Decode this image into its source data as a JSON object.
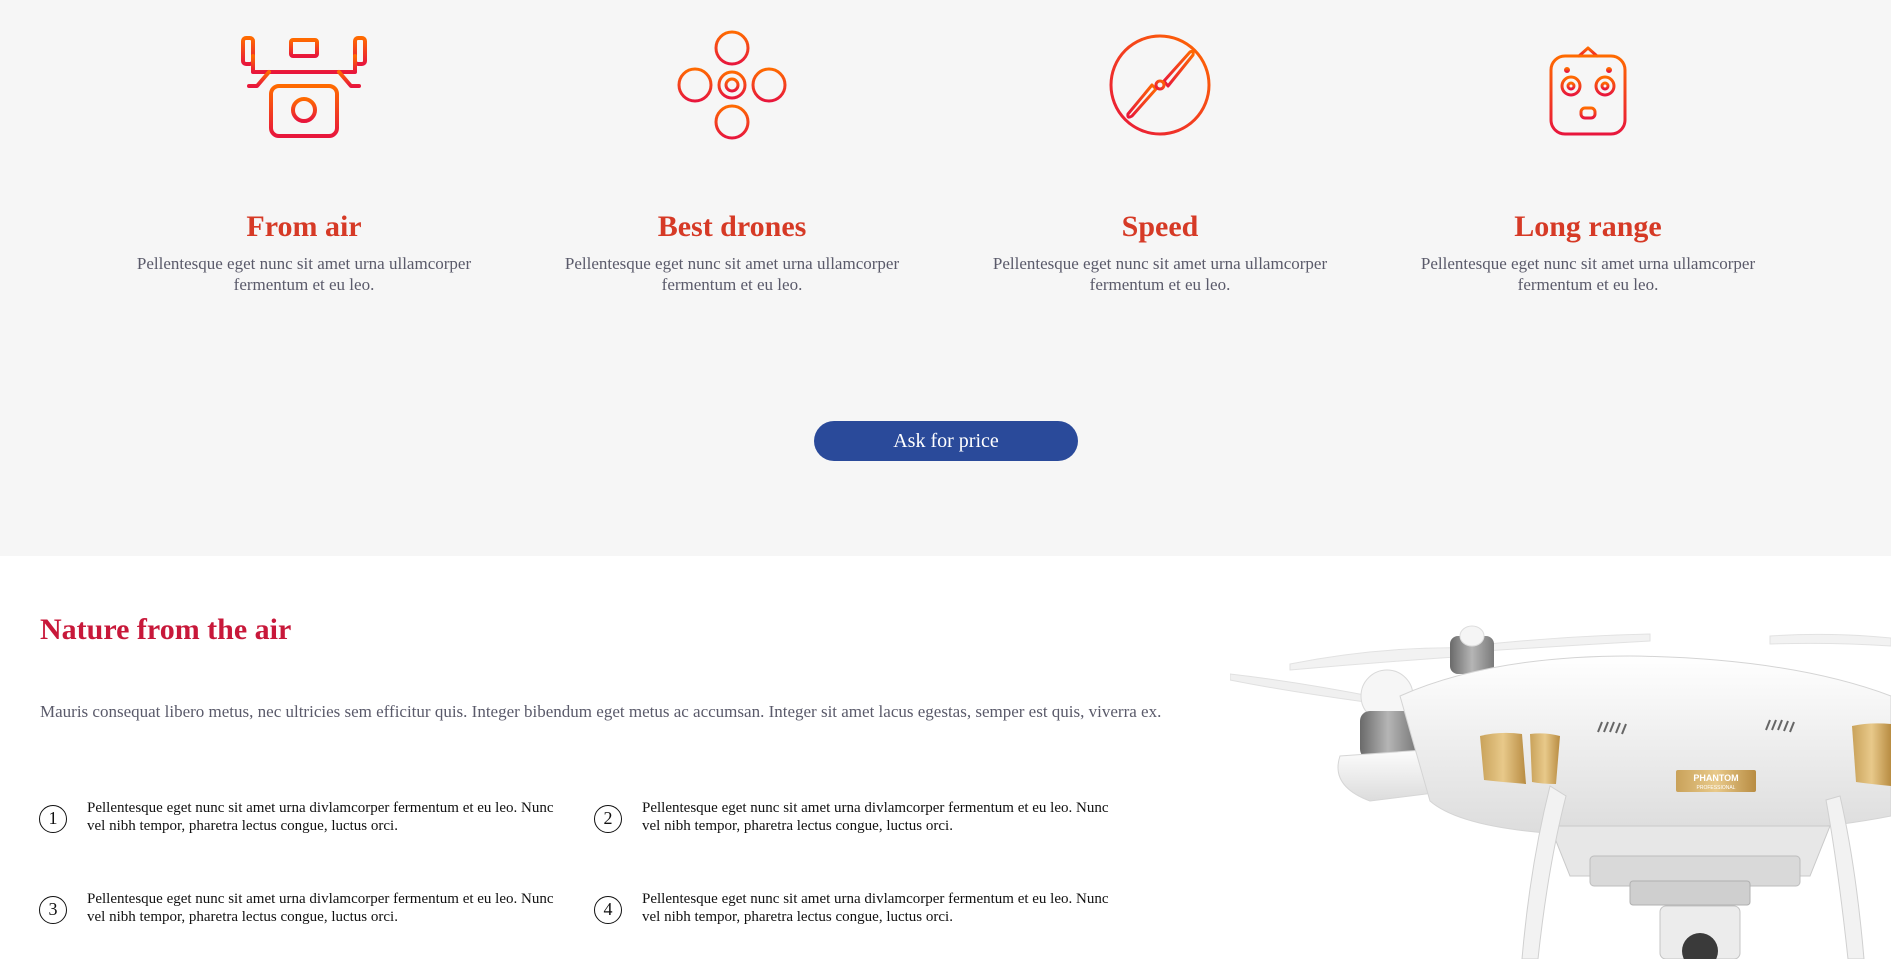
{
  "features": [
    {
      "icon": "camera-drone-icon",
      "title": "From air",
      "text": "Pellentesque eget nunc sit amet urna ullamcorper fermentum et eu leo."
    },
    {
      "icon": "quadcopter-icon",
      "title": "Best drones",
      "text": "Pellentesque eget nunc sit amet urna ullamcorper fermentum et eu leo."
    },
    {
      "icon": "propeller-icon",
      "title": "Speed",
      "text": "Pellentesque eget nunc sit amet urna ullamcorper fermentum et eu leo."
    },
    {
      "icon": "remote-controller-icon",
      "title": "Long range",
      "text": "Pellentesque eget nunc sit amet urna ullamcorper fermentum et eu leo."
    }
  ],
  "cta": {
    "label": "Ask for price"
  },
  "nature": {
    "title": "Nature from the air",
    "intro": "Mauris consequat libero metus, nec ultricies sem efficitur quis. Integer bibendum eget metus ac accumsan. Integer sit amet lacus egestas, semper est quis, viverra ex.",
    "points": [
      {
        "number": "1",
        "text": "Pellentesque eget nunc sit amet urna divlamcorper fermentum et eu leo. Nunc vel nibh tempor, pharetra lectus congue, luctus orci."
      },
      {
        "number": "2",
        "text": "Pellentesque eget nunc sit amet urna divlamcorper fermentum et eu leo. Nunc vel nibh tempor, pharetra lectus congue, luctus orci."
      },
      {
        "number": "3",
        "text": "Pellentesque eget nunc sit amet urna divlamcorper fermentum et eu leo. Nunc vel nibh tempor, pharetra lectus congue, luctus orci."
      },
      {
        "number": "4",
        "text": "Pellentesque eget nunc sit amet urna divlamcorper fermentum et eu leo. Nunc vel nibh tempor, pharetra lectus congue, luctus orci."
      }
    ],
    "photo": {
      "icon": "drone-photo",
      "badge": "PHANTOM",
      "badge_sub": "PROFESSIONAL"
    }
  },
  "colors": {
    "background": "#f6f6f6",
    "accent_orange": "#ff6a00",
    "accent_red": "#e8163c",
    "heading_red": "#d63a26",
    "title_crimson": "#c8183a",
    "button_blue": "#2a4a9a"
  }
}
